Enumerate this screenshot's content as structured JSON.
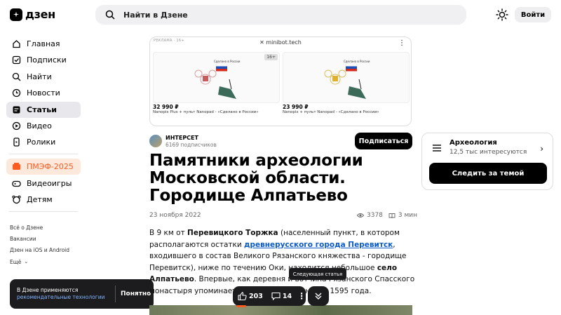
{
  "header": {
    "logo_text": "дзен",
    "search_placeholder": "Найти в Дзене",
    "login_label": "Войти"
  },
  "sidebar": {
    "items": [
      {
        "label": "Главная",
        "icon": "home-icon"
      },
      {
        "label": "Подписки",
        "icon": "check-square-icon"
      },
      {
        "label": "Найти",
        "icon": "search-icon"
      },
      {
        "label": "Новости",
        "icon": "clock-icon"
      },
      {
        "label": "Статьи",
        "icon": "article-icon"
      },
      {
        "label": "Видео",
        "icon": "play-icon"
      },
      {
        "label": "Ролики",
        "icon": "phone-icon"
      }
    ],
    "promo": {
      "label": "ПМЭФ-2025",
      "color": "#ff5a1f"
    },
    "extra": [
      {
        "label": "Видеоигры",
        "icon": "gamepad-icon"
      },
      {
        "label": "Детям",
        "icon": "bear-icon"
      }
    ],
    "footer": [
      "Всё о Дзене",
      "Вакансии",
      "Дзен на iOS и Android",
      "Ещё"
    ]
  },
  "cookie": {
    "text": "В Дзене применяются",
    "link": "рекомендательные технологии",
    "ok_label": "Понятно"
  },
  "ad": {
    "label": "РЕКЛАМА · 16+",
    "site": "minibot.tech",
    "age": "16+",
    "tile_caption": "Сделано в России",
    "items": [
      {
        "price": "32 990 ₽",
        "desc": "Nanopix Plus + пульт Nanopad - «Сделано в России»"
      },
      {
        "price": "23 990 ₽",
        "desc": "Nanopix + пульт Nanopad - «Сделано в России»"
      }
    ]
  },
  "author": {
    "name": "ИНТЕРСЕТ",
    "subscribers": "6169 подписчиков",
    "subscribe_label": "Подписаться"
  },
  "article": {
    "title": "Памятники археологии Московской области. Городище Алпатьево",
    "date": "23 ноября 2022",
    "views": "3378",
    "read_time": "3 мин",
    "p_1": "В 9 км от ",
    "p_b1": "Перевицкого Торжка",
    "p_2": " (населенный пункт, в котором располагаются остатки ",
    "p_link": "древнерусского города Перевитск",
    "p_3": ", входившего в состав Великого Рязанского княжества - городище Перевитск), ниже по течению Оки, находится небольшое ",
    "p_b2": "село Алпатьево",
    "p_4": ". Впервые, как деревня и вотчина Рязанского Спасского монастыря упоминается в платежных книгах 1595 года."
  },
  "actions": {
    "likes": "203",
    "comments": "14",
    "next_tooltip": "Следующая статья"
  },
  "topic": {
    "name": "Археология",
    "count": "12,5 тыс интересуются",
    "follow_label": "Следить за темой"
  }
}
